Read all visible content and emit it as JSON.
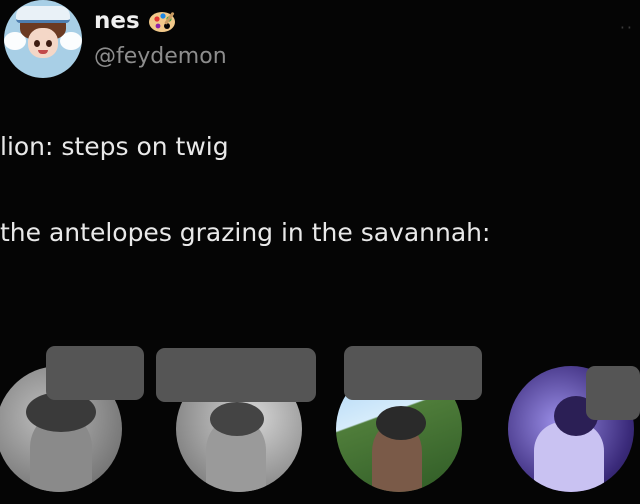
{
  "tweet": {
    "display_name": "nes",
    "handle": "@feydemon",
    "emoji_icon": "artist-palette-icon",
    "more_icon": "more-options-icon",
    "line1": "lion: steps on twig",
    "line2": "the antelopes grazing in the savannah:"
  },
  "photos": [
    {
      "name": "photo-1",
      "tone": "grayscale"
    },
    {
      "name": "photo-2",
      "tone": "grayscale"
    },
    {
      "name": "photo-3",
      "tone": "color-outdoor"
    },
    {
      "name": "photo-4",
      "tone": "purple-tint"
    }
  ],
  "colors": {
    "background": "#050505",
    "text": "#e9e9e9",
    "handle": "#8d8d8d",
    "redaction": "#555555"
  }
}
